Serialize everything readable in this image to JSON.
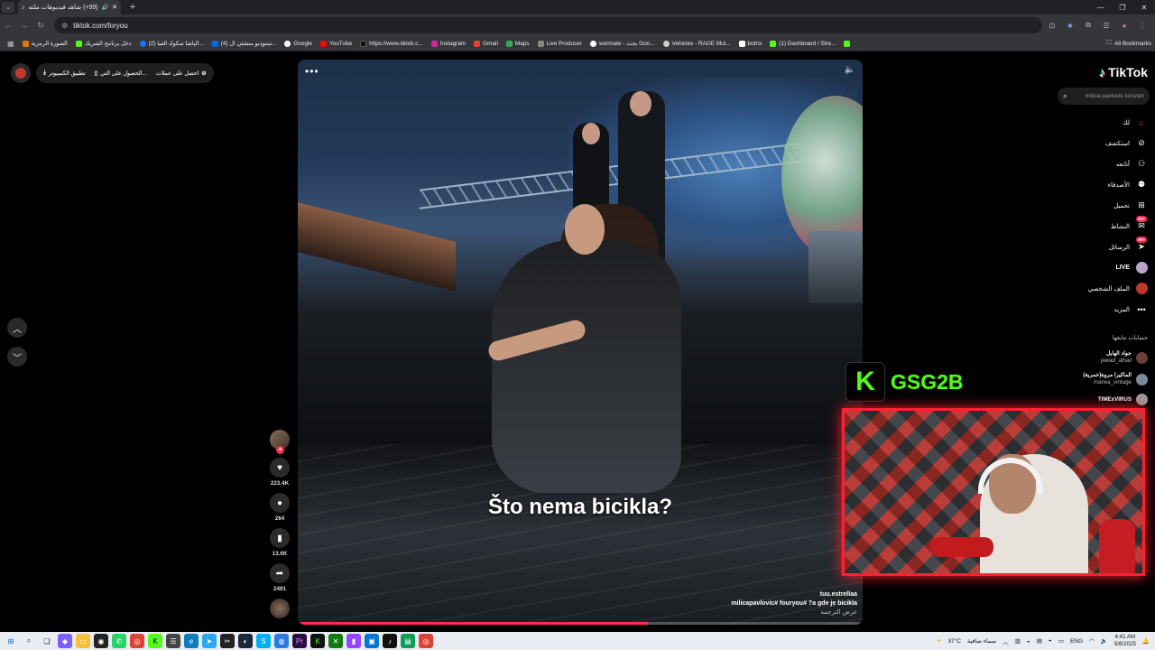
{
  "browser": {
    "tab_title": "(99+) شاهد فيديوهات ملتص...",
    "url": "tiktok.com/foryou",
    "bookmarks": [
      {
        "label": "الصورة الرمزية",
        "color": "#e37400"
      },
      {
        "label": "دخل برنامج الشريك",
        "color": "#53fc18"
      },
      {
        "label": "(2) الباشا سكواد الفيا...",
        "color": "#1877f2"
      },
      {
        "label": "(4) ستوديو منشئي ال...",
        "color": "#0668e1"
      },
      {
        "label": "Google",
        "color": "#ffffff"
      },
      {
        "label": "YouTube",
        "color": "#ff0000"
      },
      {
        "label": "https://www.tiktok.c...",
        "color": "#111111"
      },
      {
        "label": "Instagram",
        "color": "#d6249f"
      },
      {
        "label": "Gmail",
        "color": "#ea4335"
      },
      {
        "label": "Maps",
        "color": "#34a853"
      },
      {
        "label": "Live Producer",
        "color": "#888888"
      },
      {
        "label": "wormate - بحث Goo...",
        "color": "#ffffff"
      },
      {
        "label": "Vehicles - RAGE Mul...",
        "color": "#cccccc"
      },
      {
        "label": "botrix",
        "color": "#ffffff"
      },
      {
        "label": "(1) Dashboard / Stre...",
        "color": "#53fc18"
      },
      {
        "label": "",
        "color": "#53fc18"
      }
    ],
    "all_bookmarks": "All Bookmarks"
  },
  "top_left": {
    "coins": "احصل على عملات",
    "get_app": "الحصول على التي...",
    "desktop_app": "تطبيق الكمبيوتر"
  },
  "video": {
    "subtitle": "Što nema bicikla?",
    "username": "tuu.estrellaa",
    "description": "milicapavlovic# fouryou# ?a gde je bicikla",
    "translate": "عرض الترجمة",
    "progress": 0.62
  },
  "actions": {
    "likes": "223.4K",
    "comments": "264",
    "saves": "13.6K",
    "shares": "2491"
  },
  "sidebar": {
    "brand": "TikTok",
    "search_placeholder": "milica pavlovic konzert",
    "nav": [
      {
        "label": "لك",
        "icon": "home-icon",
        "glyph": "⌂",
        "active": true,
        "badge": ""
      },
      {
        "label": "استكشف",
        "icon": "compass-icon",
        "glyph": "⊘",
        "active": false,
        "badge": ""
      },
      {
        "label": "أتابعه",
        "icon": "user-follow-icon",
        "glyph": "⚇",
        "active": false,
        "badge": ""
      },
      {
        "label": "الأصدقاء",
        "icon": "friends-icon",
        "glyph": "⚉",
        "active": false,
        "badge": ""
      },
      {
        "label": "تحميل",
        "icon": "upload-icon",
        "glyph": "⊞",
        "active": false,
        "badge": ""
      },
      {
        "label": "النشاط",
        "icon": "activity-icon",
        "glyph": "✉",
        "active": false,
        "badge": "99+"
      },
      {
        "label": "الرسائل",
        "icon": "messages-icon",
        "glyph": "➤",
        "active": false,
        "badge": "99+"
      },
      {
        "label": "LIVE",
        "icon": "live-icon",
        "glyph": "",
        "active": false,
        "badge": ""
      },
      {
        "label": "الملف الشخصي",
        "icon": "profile-icon",
        "glyph": "",
        "active": false,
        "badge": ""
      },
      {
        "label": "المزيد",
        "icon": "more-icon",
        "glyph": "•••",
        "active": false,
        "badge": ""
      }
    ],
    "following_title": "حسابات تتابعها",
    "accounts": [
      {
        "name": "جواد الهايل",
        "handle": "jawad_alhail"
      },
      {
        "name": "الماكيرا مروة(خمرية)",
        "handle": "marwa_vintage"
      },
      {
        "name": "TIMExVIRUS",
        "handle": ""
      }
    ]
  },
  "stream_overlay": {
    "k_letter": "K",
    "channel": "GSG2B"
  },
  "taskbar": {
    "temperature": "37°C",
    "weather": "سماء صافية",
    "lang": "ENG",
    "time": "4:41 AM",
    "date": "5/8/2025"
  }
}
